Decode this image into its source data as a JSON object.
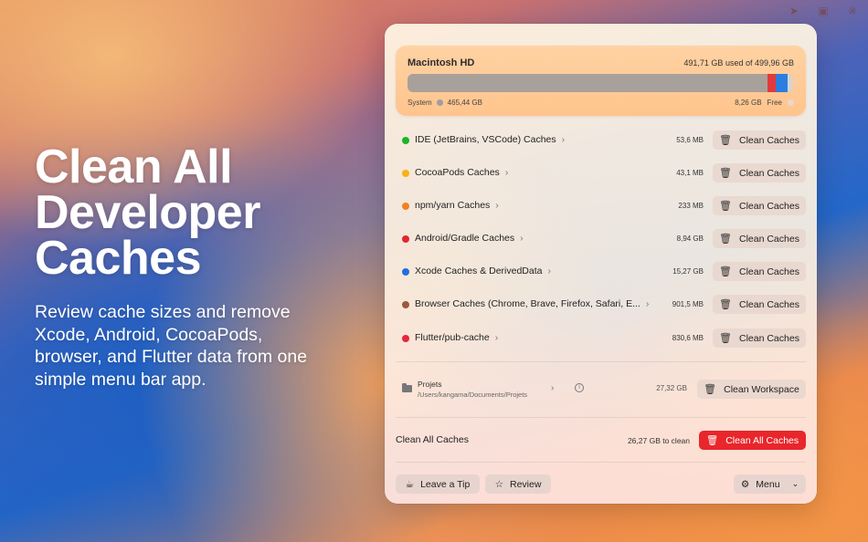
{
  "hero": {
    "title_line1": "Clean All",
    "title_line2": "Developer",
    "title_line3": "Caches",
    "subtitle": "Review cache sizes and remove Xcode, Android, CocoaPods, browser, and Flutter data from one simple menu bar app."
  },
  "menubar": {
    "icons": [
      "send-icon",
      "window-icon",
      "bluetooth-icon"
    ]
  },
  "disk": {
    "name": "Macintosh HD",
    "usage": "491,71 GB used of 499,96 GB",
    "system_label": "System",
    "system_size": "465,44 GB",
    "free_size": "8,26 GB",
    "free_label": "Free",
    "used_fraction": 0.9835,
    "colors": {
      "system": "#a8a19b",
      "caches_red": "#e23a3a",
      "caches_blue": "#2b7de0"
    }
  },
  "caches": [
    {
      "label": "IDE (JetBrains, VSCode) Caches",
      "size": "53,6 MB",
      "color": "#1bb52a",
      "button": "Clean Caches"
    },
    {
      "label": "CocoaPods Caches",
      "size": "43,1 MB",
      "color": "#f6b315",
      "button": "Clean Caches"
    },
    {
      "label": "npm/yarn Caches",
      "size": "233 MB",
      "color": "#f2821f",
      "button": "Clean Caches"
    },
    {
      "label": "Android/Gradle Caches",
      "size": "8,94 GB",
      "color": "#e4262c",
      "button": "Clean Caches"
    },
    {
      "label": "Xcode Caches & DerivedData",
      "size": "15,27 GB",
      "color": "#1f6fe0",
      "button": "Clean Caches"
    },
    {
      "label": "Browser Caches (Chrome, Brave, Firefox, Safari, E...",
      "size": "901,5 MB",
      "color": "#9a5a3e",
      "button": "Clean Caches"
    },
    {
      "label": "Flutter/pub-cache",
      "size": "830,6 MB",
      "color": "#e8263f",
      "button": "Clean Caches"
    }
  ],
  "workspace": {
    "name": "Projets",
    "path": "/Users/kangama/Documents/Projets",
    "size": "27,32 GB",
    "button": "Clean Workspace"
  },
  "clean_all": {
    "label": "Clean All Caches",
    "total": "26,27 GB to clean",
    "button": "Clean All Caches"
  },
  "footer": {
    "tip": "Leave a Tip",
    "review": "Review",
    "menu": "Menu"
  }
}
